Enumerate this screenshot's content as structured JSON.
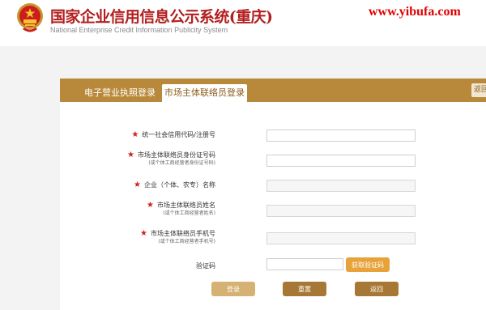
{
  "header": {
    "title": "国家企业信用信息公示系统(重庆)",
    "subtitle": "National Enterprise Credit Information Publicity System",
    "watermark": "www.yibufa.com"
  },
  "tabs": {
    "license_login": "电子营业执照登录",
    "contact_login": "市场主体联络员登录",
    "back_top": "返回"
  },
  "form": {
    "required_mark": "★",
    "credit_code_label": "统一社会信用代码/注册号",
    "id_label": "市场主体联络员身份证号码",
    "id_note": "(或个体工商经营者身份证号码)",
    "company_name_label": "企业（个体、农专）名称",
    "contact_name_label": "市场主体联络员姓名",
    "contact_name_note": "(或个体工商经营者姓名)",
    "phone_label": "市场主体联络员手机号",
    "phone_note": "(或个体工商经营者手机号)",
    "captcha_label": "验证码",
    "get_code": "获取验证码"
  },
  "actions": {
    "login": "登录",
    "reset": "重置",
    "back": "返回"
  },
  "colors": {
    "brand_gold": "#b8893a",
    "title_red": "#b31f1f",
    "required_red": "#d02020",
    "code_button": "#e7a23a"
  }
}
